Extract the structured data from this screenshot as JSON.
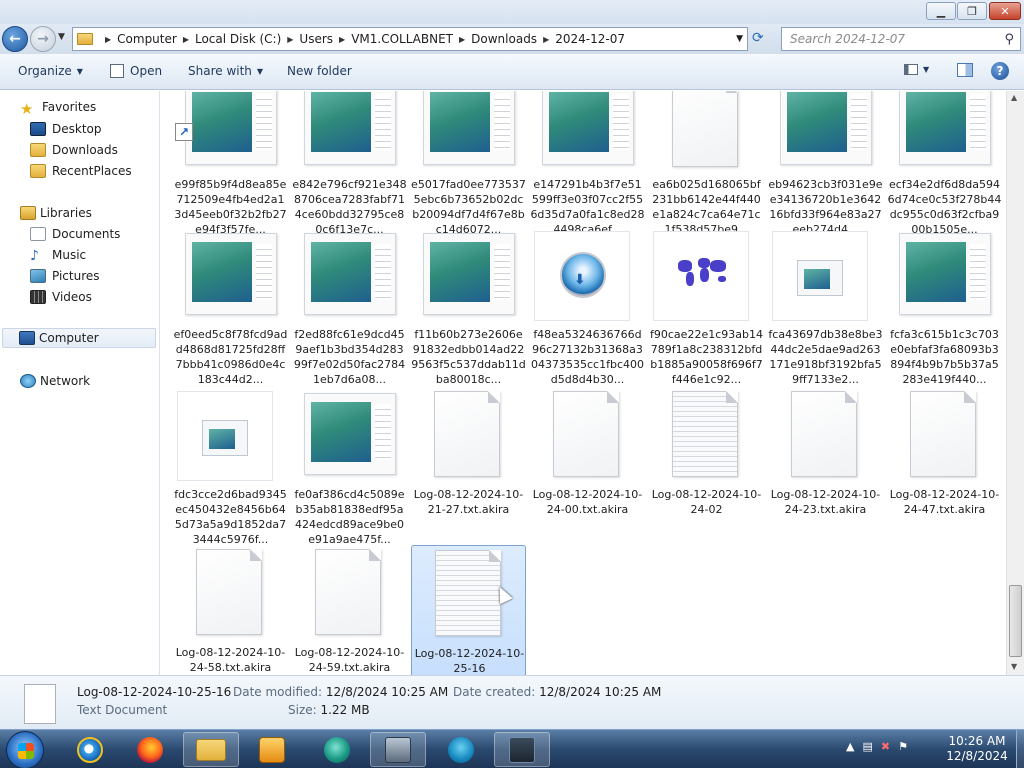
{
  "address": {
    "crumbs": [
      "Computer",
      "Local Disk (C:)",
      "Users",
      "VM1.COLLABNET",
      "Downloads",
      "2024-12-07"
    ],
    "search_placeholder": "Search 2024-12-07"
  },
  "toolbar": {
    "organize": "Organize",
    "open": "Open",
    "share_with": "Share with",
    "new_folder": "New folder"
  },
  "nav": {
    "favorites": "Favorites",
    "desktop": "Desktop",
    "downloads": "Downloads",
    "recent_places": "RecentPlaces",
    "libraries": "Libraries",
    "documents": "Documents",
    "music": "Music",
    "pictures": "Pictures",
    "videos": "Videos",
    "computer": "Computer",
    "network": "Network"
  },
  "files": [
    {
      "kind": "img",
      "shortcut": true,
      "name": "e99f85b9f4d8ea85e712509e4fb4ed2a13d45eeb0f32b2fb27e94f3f57fe..."
    },
    {
      "kind": "img",
      "name": "e842e796cf921e3488706cea7283fabf714ce60bdd32795ce80c6f13e7c..."
    },
    {
      "kind": "img",
      "name": "e5017fad0ee7735375ebc6b73652b02dcb20094df7d4f67e8bc14d6072..."
    },
    {
      "kind": "img",
      "name": "e147291b4b3f7e51599ff3e03f07cc2f556d35d7a0fa1c8ed284498ca6ef..."
    },
    {
      "kind": "doc",
      "name": "ea6b025d168065bf231bb6142e44f440e1a824c7ca64e71c1f538d57be9..."
    },
    {
      "kind": "img",
      "name": "eb94623cb3f031e9ee34136720b1e364216bfd33f964e83a27eeb274d4..."
    },
    {
      "kind": "img",
      "name": "ecf34e2df6d8da5946d74ce0c53f278b44dc955c0d63f2cfba900b1505e..."
    },
    {
      "kind": "img",
      "name": "ef0eed5c8f78fcd9add4868d81725fd28ff7bbb41c0986d0e4c183c44d2..."
    },
    {
      "kind": "img",
      "name": "f2ed88fc61e9dcd459aef1b3bd354d28399f7e02d50fac27841eb7d6a08..."
    },
    {
      "kind": "img",
      "name": "f11b60b273e2606e91832edbb014ad229563f5c537ddab11dba80018c..."
    },
    {
      "kind": "disc",
      "name": "f48ea5324636766d96c27132b31368a304373535cc1fbc400d5d8d4b30..."
    },
    {
      "kind": "map",
      "name": "f90cae22e1c93ab14789f1a8c238312bfdb1885a90058f696f7f446e1c92..."
    },
    {
      "kind": "small",
      "name": "fca43697db38e8be344dc2e5dae9ad263171e918bf3192bfa59ff7133e2..."
    },
    {
      "kind": "img",
      "name": "fcfa3c615b1c3c703e0ebfaf3fa68093b3894f4b9b7b5b37a5283e419f440..."
    },
    {
      "kind": "small",
      "name": "fdc3cce2d6bad9345ec450432e8456b645d73a5a9d1852da73444c5976f..."
    },
    {
      "kind": "img",
      "name": "fe0af386cd4c5089eb35ab81838edf95a424edcd89ace9be0e91a9ae475f..."
    },
    {
      "kind": "doc",
      "name": "Log-08-12-2024-10-21-27.txt.akira"
    },
    {
      "kind": "doc",
      "name": "Log-08-12-2024-10-24-00.txt.akira"
    },
    {
      "kind": "doclined",
      "name": "Log-08-12-2024-10-24-02"
    },
    {
      "kind": "doc",
      "name": "Log-08-12-2024-10-24-23.txt.akira"
    },
    {
      "kind": "doc",
      "name": "Log-08-12-2024-10-24-47.txt.akira"
    },
    {
      "kind": "doc",
      "name": "Log-08-12-2024-10-24-58.txt.akira"
    },
    {
      "kind": "doc",
      "name": "Log-08-12-2024-10-24-59.txt.akira"
    },
    {
      "kind": "doclined",
      "selected": true,
      "name": "Log-08-12-2024-10-25-16"
    }
  ],
  "details": {
    "name": "Log-08-12-2024-10-25-16",
    "type": "Text Document",
    "modified_label": "Date modified:",
    "modified": "12/8/2024 10:25 AM",
    "size_label": "Size:",
    "size": "1.22 MB",
    "created_label": "Date created:",
    "created": "12/8/2024 10:25 AM"
  },
  "taskbar": {
    "time": "10:26 AM",
    "date": "12/8/2024"
  },
  "colors": {
    "selection": "#cce4fd",
    "accent": "#1d5aa3"
  }
}
